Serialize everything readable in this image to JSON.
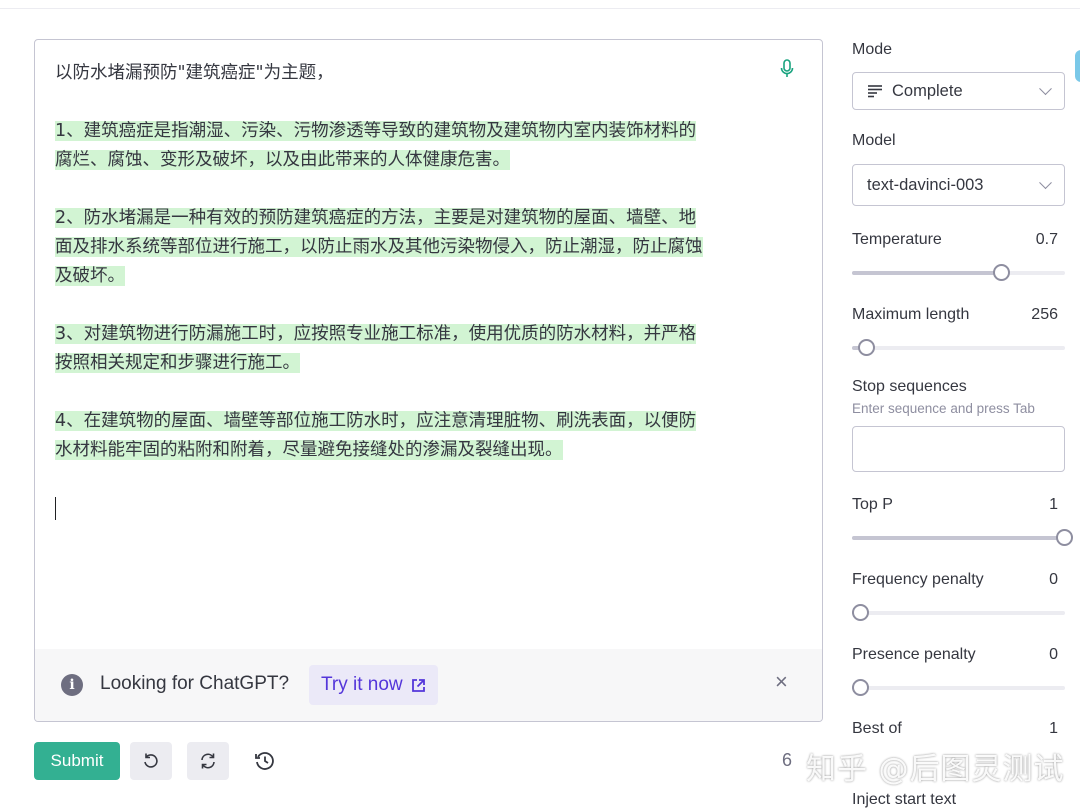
{
  "editor": {
    "prompt": "以防水堵漏预防\"建筑癌症\"为主题，",
    "completion": [
      [
        "1、建筑癌症是指潮湿、污染、污物渗透等导致的建筑物及建筑物内室内装饰材料的",
        "腐烂、腐蚀、变形及破坏，以及由此带来的人体健康危害。"
      ],
      [
        "2、防水堵漏是一种有效的预防建筑癌症的方法，主要是对建筑物的屋面、墙壁、地",
        "面及排水系统等部位进行施工，以防止雨水及其他污染物侵入，防止潮湿，防止腐蚀",
        "及破坏。"
      ],
      [
        "3、对建筑物进行防漏施工时，应按照专业施工标准，使用优质的防水材料，并严格",
        "按照相关规定和步骤进行施工。"
      ],
      [
        "4、在建筑物的屋面、墙壁等部位施工防水时，应注意清理脏物、刷洗表面，以便防",
        "水材料能牢固的粘附和附着，尽量避免接缝处的渗漏及裂缝出现。"
      ]
    ],
    "icons": {
      "mic": "microphone-icon"
    }
  },
  "banner": {
    "text": "Looking for ChatGPT?",
    "button": "Try it now",
    "close": "×"
  },
  "bottom": {
    "submit": "Submit",
    "token_count": "6",
    "watermark": "知乎 @后图灵测试",
    "icons": [
      "undo-icon",
      "regenerate-icon",
      "history-icon"
    ]
  },
  "panel": {
    "mode_label": "Mode",
    "mode_value": "Complete",
    "model_label": "Model",
    "model_value": "text-davinci-003",
    "temperature_label": "Temperature",
    "temperature_value": "0.7",
    "temperature_fraction": 0.7,
    "max_length_label": "Maximum length",
    "max_length_value": "256",
    "max_length_fraction": 0.064,
    "stop_label": "Stop sequences",
    "stop_hint": "Enter sequence and press Tab",
    "top_p_label": "Top P",
    "top_p_value": "1",
    "top_p_fraction": 1.0,
    "freq_label": "Frequency penalty",
    "freq_value": "0",
    "freq_fraction": 0.0,
    "presence_label": "Presence penalty",
    "presence_value": "0",
    "presence_fraction": 0.0,
    "best_of_label": "Best of",
    "best_of_value": "1",
    "inject_label": "Inject start text"
  },
  "colors": {
    "accent": "#10a37f",
    "highlight": "#d2f4d3",
    "link": "#5436da"
  }
}
